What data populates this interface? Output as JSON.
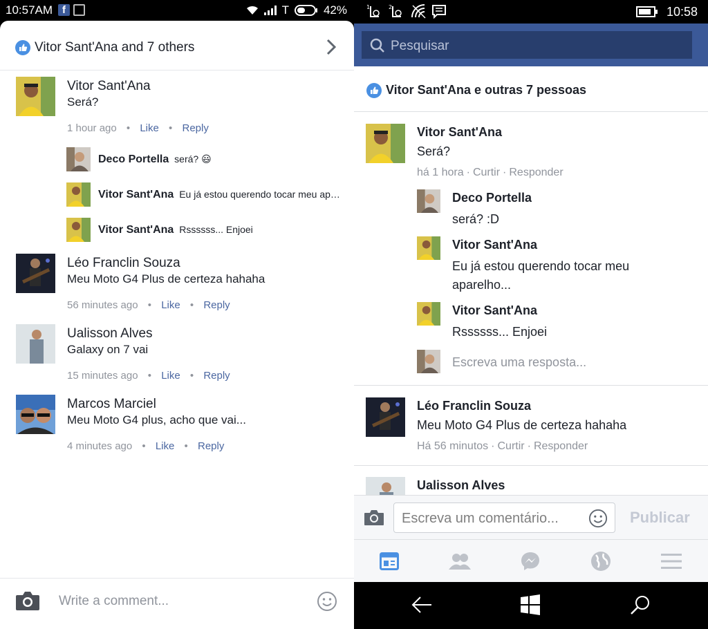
{
  "left": {
    "status": {
      "time": "10:57AM",
      "carrier": "T",
      "battery": "42%"
    },
    "likes_header": "Vitor Sant'Ana and 7 others",
    "comments": [
      {
        "name": "Vitor Sant'Ana",
        "text": "Será?",
        "time": "1 hour ago",
        "like": "Like",
        "reply": "Reply"
      },
      {
        "name": "Léo Franclin Souza",
        "text": "Meu Moto G4 Plus de certeza hahaha",
        "time": "56 minutes ago",
        "like": "Like",
        "reply": "Reply"
      },
      {
        "name": "Ualisson Alves",
        "text": "Galaxy on 7 vai",
        "time": "15 minutes ago",
        "like": "Like",
        "reply": "Reply"
      },
      {
        "name": "Marcos Marciel",
        "text": "Meu Moto G4 plus, acho que vai...",
        "time": "4 minutes ago",
        "like": "Like",
        "reply": "Reply"
      }
    ],
    "replies": [
      {
        "name": "Deco Portella",
        "text": "será? 😃"
      },
      {
        "name": "Vitor Sant'Ana",
        "text": "Eu já estou querendo tocar meu aparelho..."
      },
      {
        "name": "Vitor Sant'Ana",
        "text": "Rssssss... Enjoei"
      }
    ],
    "composer_placeholder": "Write a comment..."
  },
  "right": {
    "status": {
      "time": "10:58",
      "notif_1": "1",
      "notif_2": "2"
    },
    "search_placeholder": "Pesquisar",
    "likes_header": "Vitor Sant'Ana e outras 7 pessoas",
    "comments": [
      {
        "name": "Vitor Sant'Ana",
        "text": "Será?",
        "time": "há 1 hora",
        "like": "Curtir",
        "reply": "Responder"
      },
      {
        "name": "Léo Franclin Souza",
        "text": "Meu Moto G4 Plus de certeza hahaha",
        "time": "Há 56 minutos",
        "like": "Curtir",
        "reply": "Responder"
      },
      {
        "name": "Ualisson Alves"
      }
    ],
    "replies": [
      {
        "name": "Deco Portella",
        "text": "será? :D"
      },
      {
        "name": "Vitor Sant'Ana",
        "text": "Eu já estou querendo tocar meu aparelho..."
      },
      {
        "name": "Vitor Sant'Ana",
        "text": "Rssssss... Enjoei"
      }
    ],
    "reply_placeholder": "Escreva uma resposta...",
    "composer_placeholder": "Escreva um comentário...",
    "publish_label": "Publicar",
    "dot": "·"
  },
  "dot": "•",
  "colors": {
    "facebook_blue": "#3b5998",
    "link_blue": "#4b67a1",
    "like_blue": "#4a90e2",
    "meta_gray": "#90949c",
    "tab_active": "#4a90e2"
  },
  "icons": [
    "facebook-icon",
    "wifi-icon",
    "signal-icon",
    "battery-icon",
    "like-icon",
    "chevron-right-icon",
    "camera-icon",
    "emoji-icon",
    "search-icon",
    "news-feed-icon",
    "friends-icon",
    "messenger-icon",
    "globe-icon",
    "menu-icon",
    "back-icon",
    "windows-icon"
  ]
}
